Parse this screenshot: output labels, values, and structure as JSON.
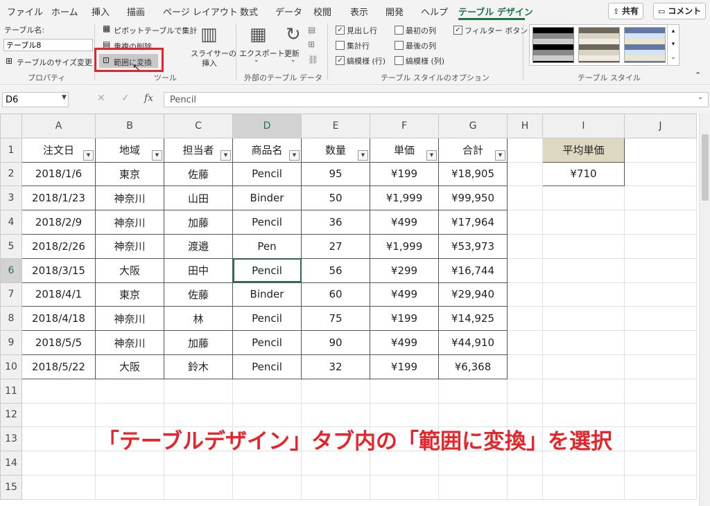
{
  "tabs": [
    "ファイル",
    "ホーム",
    "挿入",
    "描画",
    "ページ レイアウト",
    "数式",
    "データ",
    "校閲",
    "表示",
    "開発",
    "ヘルプ",
    "テーブル デザイン"
  ],
  "share_label": "共有",
  "comment_label": "コメント",
  "ribbon": {
    "table_name_label": "テーブル名:",
    "table_name_value": "テーブル8",
    "resize_label": "テーブルのサイズ変更",
    "group_properties": "プロパティ",
    "pivot_label": "ピボットテーブルで集計",
    "remove_dup_label": "重複の削除",
    "convert_label": "範囲に変換",
    "group_tools": "ツール",
    "slicer_label_1": "スライサーの",
    "slicer_label_2": "挿入",
    "export_label": "エクスポート",
    "refresh_label": "更新",
    "group_external": "外部のテーブル データ",
    "opt_header_row": "見出し行",
    "opt_total_row": "集計行",
    "opt_banded_rows": "縞模様 (行)",
    "opt_first_col": "最初の列",
    "opt_last_col": "最後の列",
    "opt_banded_cols": "縞模様 (列)",
    "opt_filter_button": "フィルター ボタン",
    "group_style_options": "テーブル スタイルのオプション",
    "group_table_styles": "テーブル スタイル"
  },
  "formula_bar": {
    "name_box": "D6",
    "fx": "fx",
    "value": "Pencil"
  },
  "columns": [
    "A",
    "B",
    "C",
    "D",
    "E",
    "F",
    "G",
    "H",
    "I",
    "J"
  ],
  "rows": [
    "1",
    "2",
    "3",
    "4",
    "5",
    "6",
    "7",
    "8",
    "9",
    "10",
    "11",
    "12",
    "13",
    "14",
    "15"
  ],
  "table": {
    "headers": [
      "注文日",
      "地域",
      "担当者",
      "商品名",
      "数量",
      "単価",
      "合計"
    ],
    "data": [
      [
        "2018/1/6",
        "東京",
        "佐藤",
        "Pencil",
        "95",
        "¥199",
        "¥18,905"
      ],
      [
        "2018/1/23",
        "神奈川",
        "山田",
        "Binder",
        "50",
        "¥1,999",
        "¥99,950"
      ],
      [
        "2018/2/9",
        "神奈川",
        "加藤",
        "Pencil",
        "36",
        "¥499",
        "¥17,964"
      ],
      [
        "2018/2/26",
        "神奈川",
        "渡邉",
        "Pen",
        "27",
        "¥1,999",
        "¥53,973"
      ],
      [
        "2018/3/15",
        "大阪",
        "田中",
        "Pencil",
        "56",
        "¥299",
        "¥16,744"
      ],
      [
        "2018/4/1",
        "東京",
        "佐藤",
        "Binder",
        "60",
        "¥499",
        "¥29,940"
      ],
      [
        "2018/4/18",
        "神奈川",
        "林",
        "Pencil",
        "75",
        "¥199",
        "¥14,925"
      ],
      [
        "2018/5/5",
        "神奈川",
        "加藤",
        "Pencil",
        "90",
        "¥499",
        "¥44,910"
      ],
      [
        "2018/5/22",
        "大阪",
        "鈴木",
        "Pencil",
        "32",
        "¥199",
        "¥6,368"
      ]
    ]
  },
  "avg_header": "平均単価",
  "avg_value": "¥710",
  "annotation": "「テーブルデザイン」タブ内の「範囲に変換」を選択",
  "colors": {
    "accent": "#217346",
    "highlight": "#e8242a",
    "avg_header_bg": "#ddd8c0"
  },
  "icons": [
    "share-icon",
    "comment-icon",
    "resize-icon",
    "pivot-icon",
    "remove-duplicates-icon",
    "convert-range-icon",
    "slicer-icon",
    "export-icon",
    "refresh-icon",
    "cancel-icon",
    "enter-icon"
  ]
}
